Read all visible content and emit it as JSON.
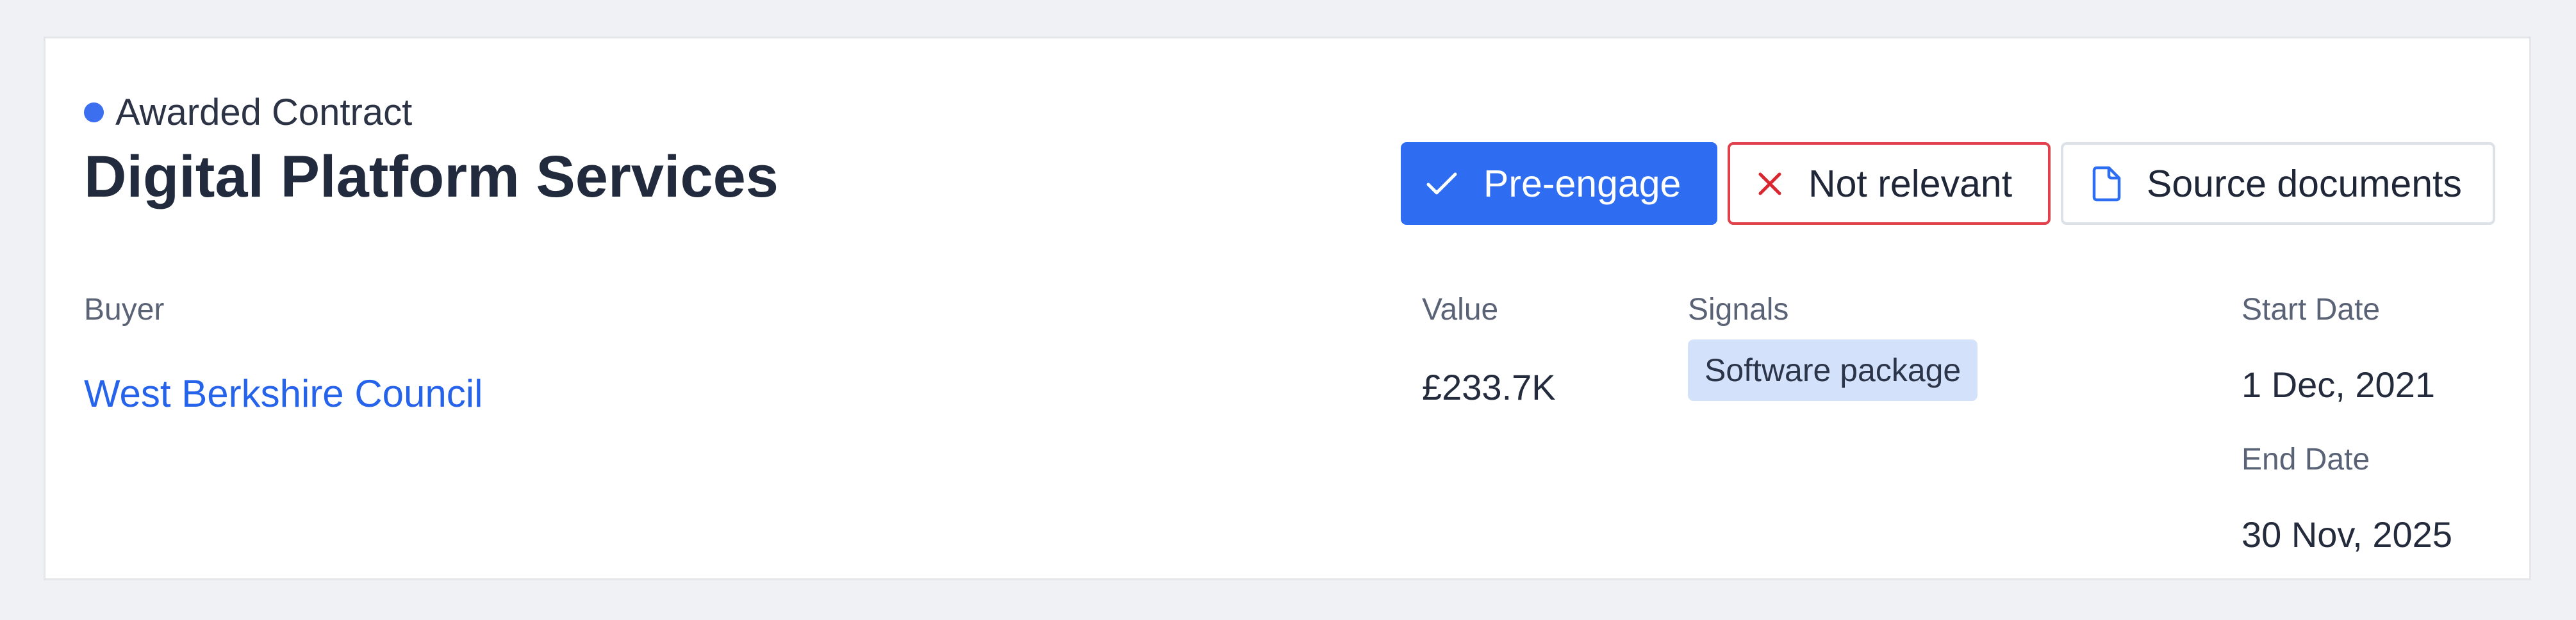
{
  "card": {
    "status_label": "Awarded Contract",
    "status_color": "#3b6ff0",
    "title": "Digital Platform Services"
  },
  "actions": {
    "pre_engage": {
      "label": "Pre-engage",
      "icon": "check-icon",
      "color": "#2e6cf2"
    },
    "not_relevant": {
      "label": "Not relevant",
      "icon": "close-icon",
      "color": "#e2404a"
    },
    "source_documents": {
      "label": "Source documents",
      "icon": "document-icon"
    }
  },
  "fields": {
    "buyer": {
      "label": "Buyer",
      "value": "West Berkshire Council"
    },
    "value": {
      "label": "Value",
      "value": "£233.7K"
    },
    "signals": {
      "label": "Signals",
      "items": [
        "Software package"
      ]
    },
    "start_date": {
      "label": "Start Date",
      "value": "1 Dec, 2021"
    },
    "end_date": {
      "label": "End Date",
      "value": "30 Nov, 2025"
    }
  }
}
